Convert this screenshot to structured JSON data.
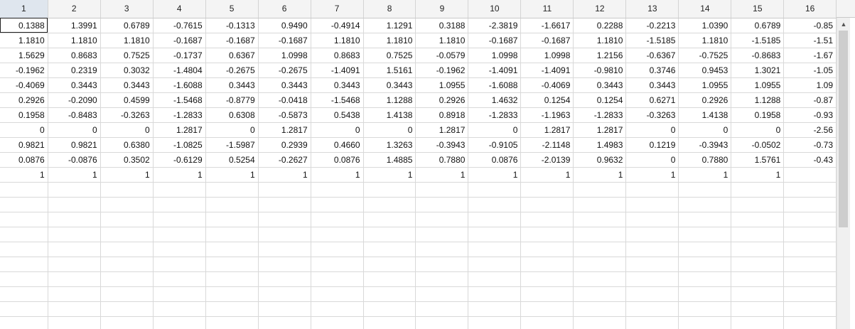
{
  "columns": [
    "1",
    "2",
    "3",
    "4",
    "5",
    "6",
    "7",
    "8",
    "9",
    "10",
    "11",
    "12",
    "13",
    "14",
    "15",
    "16"
  ],
  "rows": [
    [
      "0.1388",
      "1.3991",
      "0.6789",
      "-0.7615",
      "-0.1313",
      "0.9490",
      "-0.4914",
      "1.1291",
      "0.3188",
      "-2.3819",
      "-1.6617",
      "0.2288",
      "-0.2213",
      "1.0390",
      "0.6789",
      "-0.85"
    ],
    [
      "1.1810",
      "1.1810",
      "1.1810",
      "-0.1687",
      "-0.1687",
      "-0.1687",
      "1.1810",
      "1.1810",
      "1.1810",
      "-0.1687",
      "-0.1687",
      "1.1810",
      "-1.5185",
      "1.1810",
      "-1.5185",
      "-1.51"
    ],
    [
      "1.5629",
      "0.8683",
      "0.7525",
      "-0.1737",
      "0.6367",
      "1.0998",
      "0.8683",
      "0.7525",
      "-0.0579",
      "1.0998",
      "1.0998",
      "1.2156",
      "-0.6367",
      "-0.7525",
      "-0.8683",
      "-1.67"
    ],
    [
      "-0.1962",
      "0.2319",
      "0.3032",
      "-1.4804",
      "-0.2675",
      "-0.2675",
      "-1.4091",
      "1.5161",
      "-0.1962",
      "-1.4091",
      "-1.4091",
      "-0.9810",
      "0.3746",
      "0.9453",
      "1.3021",
      "-1.05"
    ],
    [
      "-0.4069",
      "0.3443",
      "0.3443",
      "-1.6088",
      "0.3443",
      "0.3443",
      "0.3443",
      "0.3443",
      "1.0955",
      "-1.6088",
      "-0.4069",
      "0.3443",
      "0.3443",
      "1.0955",
      "1.0955",
      "1.09"
    ],
    [
      "0.2926",
      "-0.2090",
      "0.4599",
      "-1.5468",
      "-0.8779",
      "-0.0418",
      "-1.5468",
      "1.1288",
      "0.2926",
      "1.4632",
      "0.1254",
      "0.1254",
      "0.6271",
      "0.2926",
      "1.1288",
      "-0.87"
    ],
    [
      "0.1958",
      "-0.8483",
      "-0.3263",
      "-1.2833",
      "0.6308",
      "-0.5873",
      "0.5438",
      "1.4138",
      "0.8918",
      "-1.2833",
      "-1.1963",
      "-1.2833",
      "-0.3263",
      "1.4138",
      "0.1958",
      "-0.93"
    ],
    [
      "0",
      "0",
      "0",
      "1.2817",
      "0",
      "1.2817",
      "0",
      "0",
      "1.2817",
      "0",
      "1.2817",
      "1.2817",
      "0",
      "0",
      "0",
      "-2.56"
    ],
    [
      "0.9821",
      "0.9821",
      "0.6380",
      "-1.0825",
      "-1.5987",
      "0.2939",
      "0.4660",
      "1.3263",
      "-0.3943",
      "-0.9105",
      "-2.1148",
      "1.4983",
      "0.1219",
      "-0.3943",
      "-0.0502",
      "-0.73"
    ],
    [
      "0.0876",
      "-0.0876",
      "0.3502",
      "-0.6129",
      "0.5254",
      "-0.2627",
      "0.0876",
      "1.4885",
      "0.7880",
      "0.0876",
      "-2.0139",
      "0.9632",
      "0",
      "0.7880",
      "1.5761",
      "-0.43"
    ],
    [
      "1",
      "1",
      "1",
      "1",
      "1",
      "1",
      "1",
      "1",
      "1",
      "1",
      "1",
      "1",
      "1",
      "1",
      "1",
      ""
    ]
  ],
  "empty_rows": 10,
  "selected_cell": {
    "row": 0,
    "col": 0
  },
  "scrollbar": {
    "up_icon": "up-arrow-icon",
    "glyph": "▲"
  }
}
